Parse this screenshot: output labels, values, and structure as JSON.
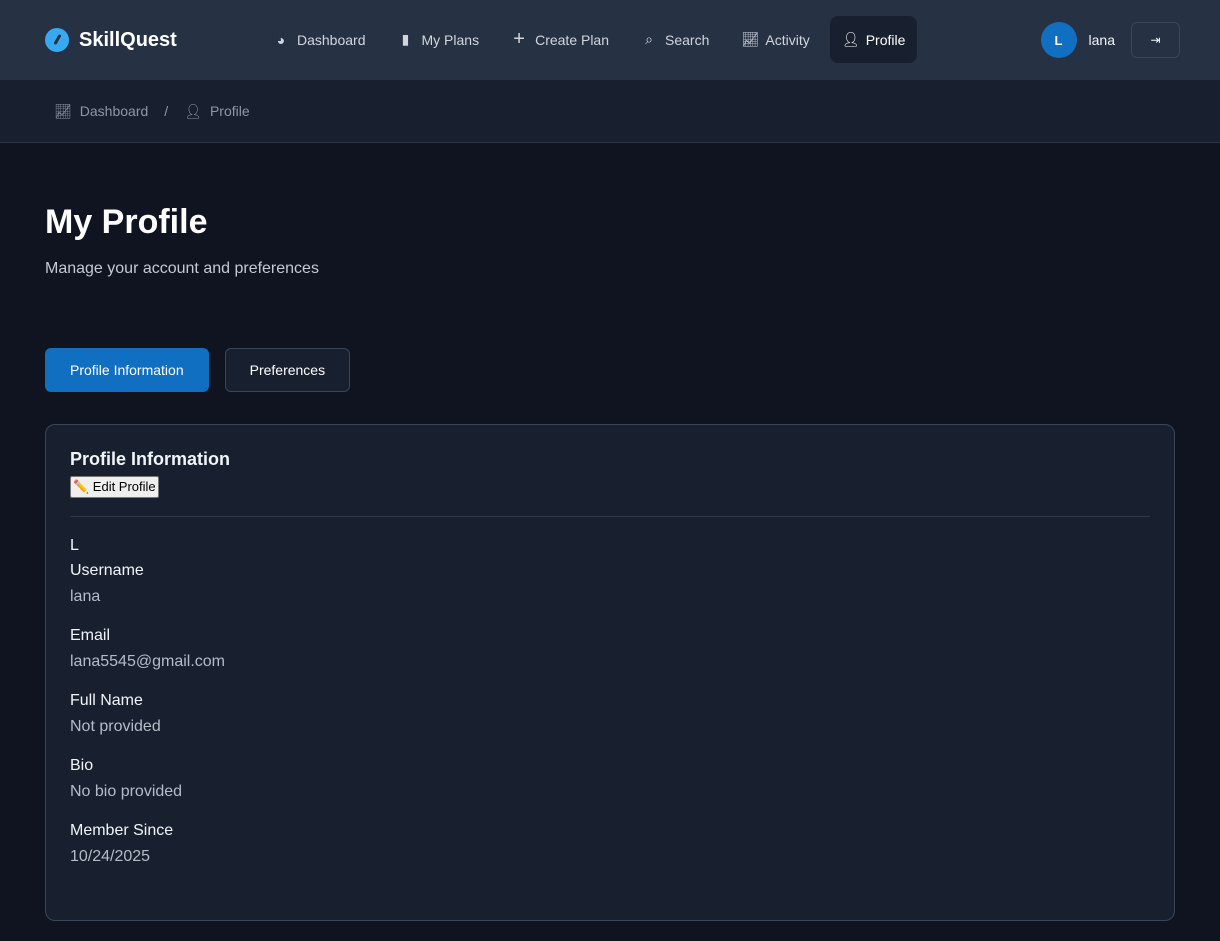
{
  "brand": "SkillQuest",
  "nav": [
    {
      "label": "Dashboard",
      "icon": "gauge-icon"
    },
    {
      "label": "My Plans",
      "icon": "book-icon"
    },
    {
      "label": "Create Plan",
      "icon": "plus-icon"
    },
    {
      "label": "Search",
      "icon": "search-icon"
    },
    {
      "label": "Activity",
      "icon": "chart-line-icon"
    },
    {
      "label": "Profile",
      "icon": "user-icon"
    }
  ],
  "user": {
    "initial": "L",
    "name": "lana"
  },
  "breadcrumb": {
    "home": "Dashboard",
    "sep": "/",
    "current": "Profile"
  },
  "page": {
    "title": "My Profile",
    "subtitle": "Manage your account and preferences"
  },
  "tabs": [
    "Profile Information",
    "Preferences"
  ],
  "card": {
    "title": "Profile Information",
    "edit": "✏️ Edit Profile",
    "initial": "L",
    "fields": [
      {
        "label": "Username",
        "value": "lana"
      },
      {
        "label": "Email",
        "value": "lana5545@gmail.com"
      },
      {
        "label": "Full Name",
        "value": "Not provided"
      },
      {
        "label": "Bio",
        "value": "No bio provided"
      },
      {
        "label": "Member Since",
        "value": "10/24/2025"
      }
    ]
  },
  "colors": {
    "accent": "#106fc0",
    "nav_bg": "#263143",
    "bg": "#0f1420"
  }
}
